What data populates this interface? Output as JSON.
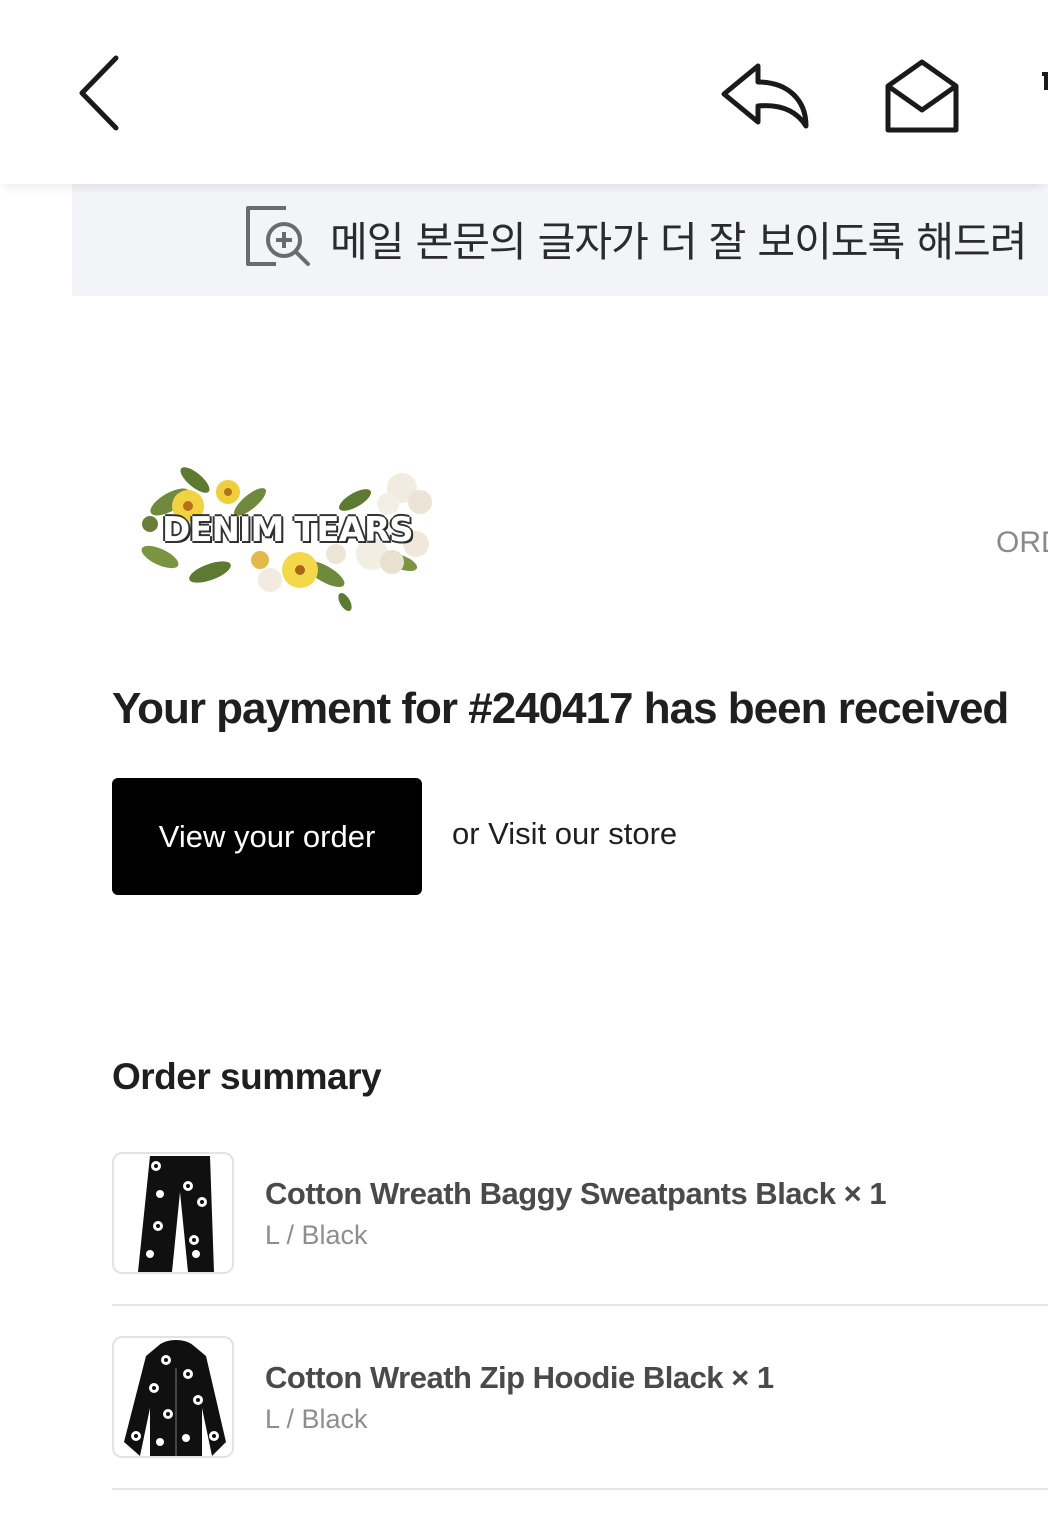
{
  "toolbar": {
    "back_icon": "chevron-left-icon",
    "reply_icon": "reply-icon",
    "mail_icon": "envelope-open-icon",
    "more_icon": "more-icon"
  },
  "banner": {
    "icon": "zoom-in-document-icon",
    "text": "메일 본문의 글자가 더 잘 보이도록 해드려"
  },
  "email": {
    "brand_logo_text": "DENIM TEARS",
    "order_label": "ORD",
    "headline": "Your payment for #240417 has been received",
    "view_order_label": "View your order",
    "visit_store_label": "or Visit our store",
    "summary_title": "Order summary",
    "items": [
      {
        "name": "Cotton Wreath Baggy Sweatpants Black × 1",
        "variant": "L / Black",
        "thumb": "sweatpants-image"
      },
      {
        "name": "Cotton Wreath Zip Hoodie Black × 1",
        "variant": "L / Black",
        "thumb": "hoodie-image"
      }
    ]
  },
  "colors": {
    "button_bg": "#000000",
    "banner_bg": "#f3f4f8",
    "muted_text": "#8e8e8e"
  }
}
